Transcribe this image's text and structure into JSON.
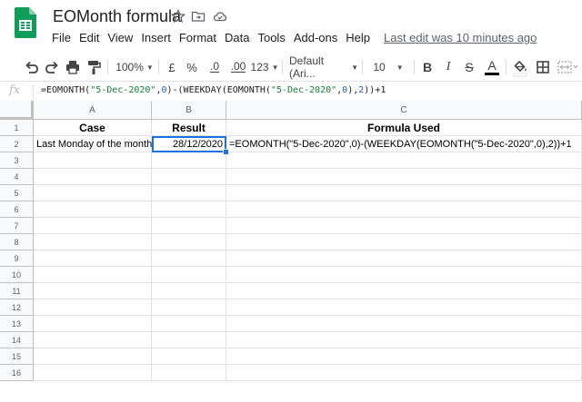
{
  "header": {
    "title": "EOMonth formula",
    "menu": [
      "File",
      "Edit",
      "View",
      "Insert",
      "Format",
      "Data",
      "Tools",
      "Add-ons",
      "Help"
    ],
    "last_edit": "Last edit was 10 minutes ago"
  },
  "toolbar": {
    "zoom": "100%",
    "currency": "£",
    "percent": "%",
    "dec_decrease": ".0",
    "dec_increase": ".00",
    "more_formats": "123",
    "font": "Default (Ari...",
    "font_size": "10",
    "bold": "B",
    "italic": "I",
    "strike": "S",
    "text_color": "A"
  },
  "formula_bar": {
    "fx": "fx",
    "parts": [
      {
        "t": "=EOMONTH(",
        "c": ""
      },
      {
        "t": "\"5-Dec-2020\"",
        "c": "str"
      },
      {
        "t": ",",
        "c": ""
      },
      {
        "t": "0",
        "c": "num"
      },
      {
        "t": ")-(WEEKDAY(EOMONTH(",
        "c": ""
      },
      {
        "t": "\"5-Dec-2020\"",
        "c": "str"
      },
      {
        "t": ",",
        "c": ""
      },
      {
        "t": "0",
        "c": "num"
      },
      {
        "t": "),",
        "c": ""
      },
      {
        "t": "2",
        "c": "num"
      },
      {
        "t": "))+1",
        "c": ""
      }
    ]
  },
  "grid": {
    "columns": [
      "A",
      "B",
      "C"
    ],
    "rows": [
      "1",
      "2",
      "3",
      "4",
      "5",
      "6",
      "7",
      "8",
      "9",
      "10",
      "11",
      "12",
      "13",
      "14",
      "15",
      "16"
    ],
    "headers": {
      "a1": "Case",
      "b1": "Result",
      "c1": "Formula Used"
    },
    "row2": {
      "a2": "Last Monday of the month",
      "b2": "28/12/2020",
      "c2": "=EOMONTH(\"5-Dec-2020\",0)-(WEEKDAY(EOMONTH(\"5-Dec-2020\",0),2))+1"
    }
  },
  "colors": {
    "sheets_green": "#0f9d58",
    "selection_blue": "#1a73e8",
    "string_green": "#188038",
    "number_blue": "#1967d2",
    "text_color_bar": "#000000"
  }
}
